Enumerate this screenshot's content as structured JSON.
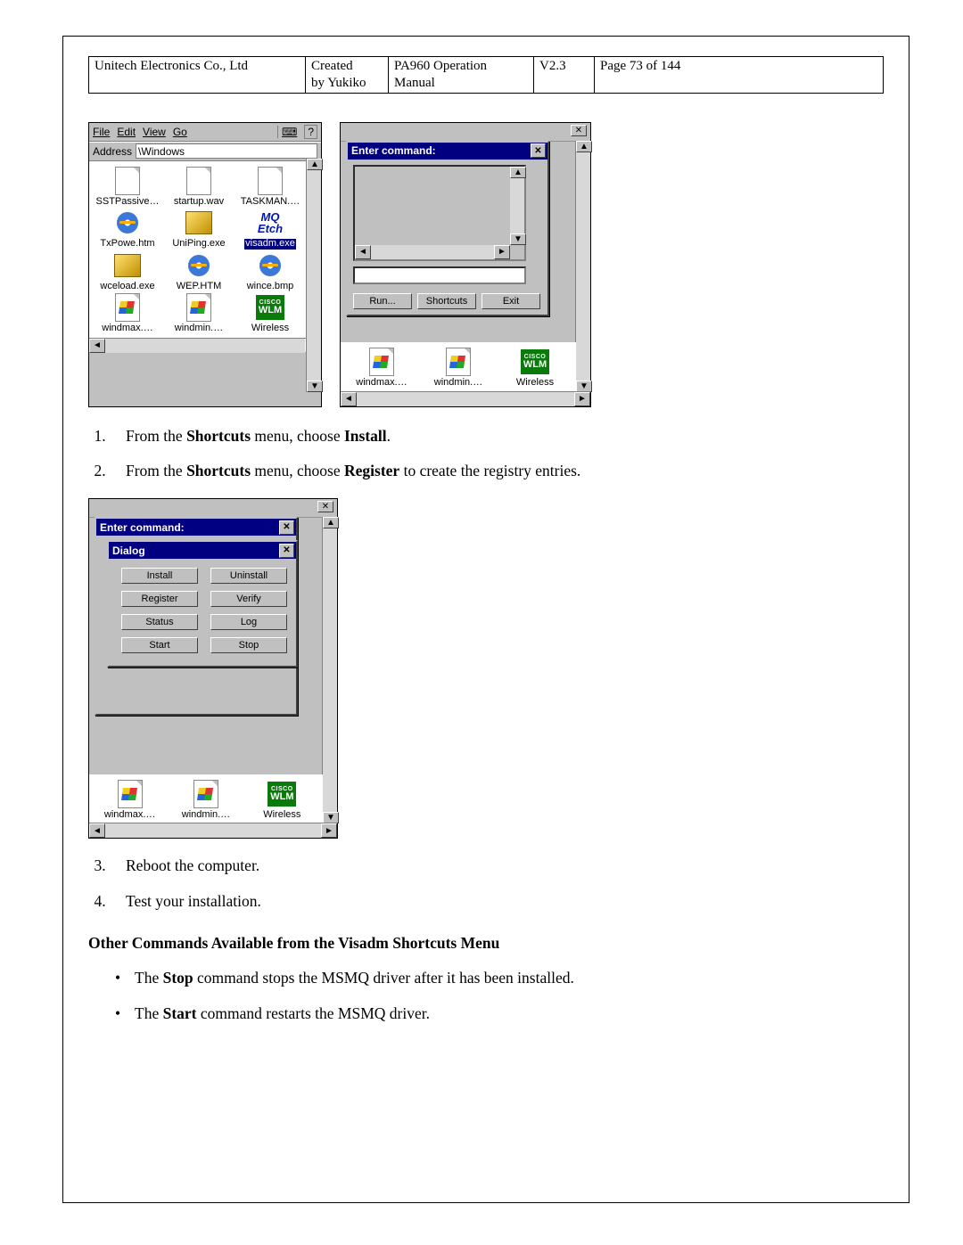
{
  "header": {
    "company": "Unitech Electronics Co., Ltd",
    "created_l1": "Created",
    "created_l2": "by Yukiko",
    "doc_l1": "PA960 Operation",
    "doc_l2": "Manual",
    "version": "V2.3",
    "page": "Page 73 of 144"
  },
  "shot1": {
    "menu": {
      "file": "File",
      "edit": "Edit",
      "view": "View",
      "go": "Go"
    },
    "address_label": "Address",
    "address_value": "\\Windows",
    "row1": [
      "SSTPassive…",
      "startup.wav",
      "TASKMAN.…"
    ],
    "row2": [
      "TxPowe.htm",
      "UniPing.exe",
      "visadm.exe"
    ],
    "row2_mq": "MQ Etch",
    "row3": [
      "wceload.exe",
      "WEP.HTM",
      "wince.bmp"
    ],
    "row4": [
      "windmax.…",
      "windmin.…",
      "Wireless"
    ],
    "wlm_top": "CISCO",
    "wlm": "WLM"
  },
  "shot2": {
    "title": "Enter command:",
    "buttons": {
      "run": "Run...",
      "shortcuts": "Shortcuts",
      "exit": "Exit"
    },
    "row4": [
      "windmax.…",
      "windmin.…",
      "Wireless"
    ],
    "wlm_top": "CISCO",
    "wlm": "WLM"
  },
  "shot3": {
    "title1": "Enter command:",
    "title2": "Dialog",
    "buttons": {
      "install": "Install",
      "uninstall": "Uninstall",
      "register": "Register",
      "verify": "Verify",
      "status": "Status",
      "log": "Log",
      "start": "Start",
      "stop": "Stop"
    },
    "row4": [
      "windmax.…",
      "windmin.…",
      "Wireless"
    ],
    "wlm_top": "CISCO",
    "wlm": "WLM"
  },
  "steps_a": [
    {
      "pre": "From the ",
      "b1": "Shortcuts",
      "mid": " menu, choose ",
      "b2": "Install",
      "post": "."
    },
    {
      "pre": "From the ",
      "b1": "Shortcuts",
      "mid": " menu, choose ",
      "b2": "Register",
      "post": " to create the registry entries."
    }
  ],
  "steps_b": [
    "Reboot the computer.",
    "Test your installation."
  ],
  "section_heading": "Other Commands Available from the Visadm Shortcuts Menu",
  "bullets": [
    {
      "pre": "The ",
      "b": "Stop",
      "post": " command stops the MSMQ driver after it has been installed."
    },
    {
      "pre": "The ",
      "b": "Start",
      "post": " command restarts the MSMQ driver."
    }
  ]
}
